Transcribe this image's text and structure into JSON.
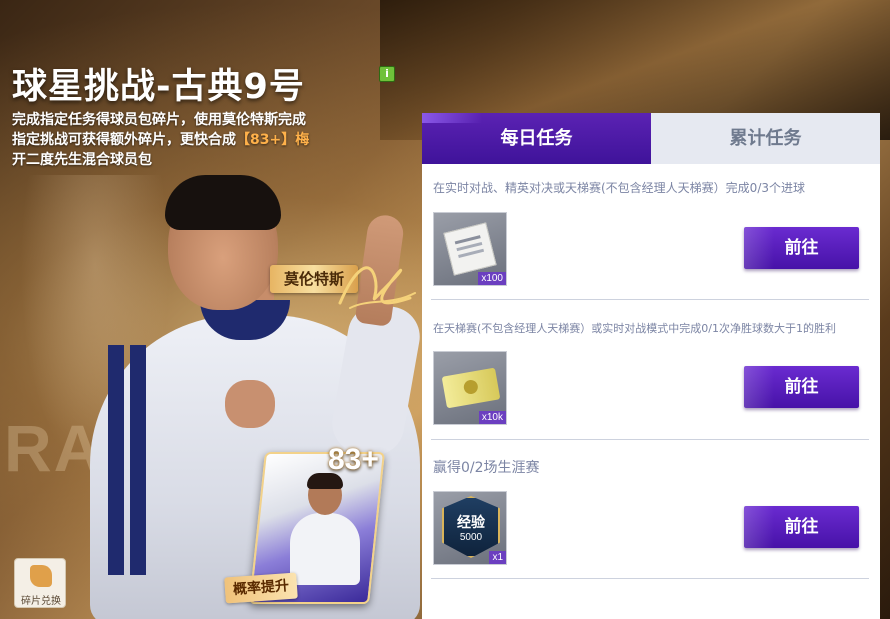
{
  "event": {
    "title": "球星挑战-古典9号",
    "info_icon": "i",
    "description_lines": [
      "完成指定任务得球员包碎片，使用莫伦特斯完成",
      "指定挑战可获得额外碎片，更快合成"
    ],
    "description_highlight": "【83+】",
    "description_tail": "梅",
    "description_last": "开二度先生混合球员包"
  },
  "hero": {
    "player_name": "莫伦特斯",
    "background_letters": "RA",
    "card_rating": "83+",
    "probability_tag": "概率提升"
  },
  "exchange": {
    "label": "碎片兑换",
    "icon": "puzzle-icon"
  },
  "tabs": [
    {
      "label": "每日任务",
      "active": true
    },
    {
      "label": "累计任务",
      "active": false
    }
  ],
  "tasks": [
    {
      "description": "在实时对战、精英对决或天梯赛(不包含经理人天梯赛）完成0/3个进球",
      "reward_icon": "document-icon",
      "reward_qty": "x100",
      "button": "前往"
    },
    {
      "description": "在天梯赛(不包含经理人天梯赛）或实时对战模式中完成0/1次净胜球数大于1的胜利",
      "reward_icon": "ticket-icon",
      "reward_qty": "x10k",
      "button": "前往"
    },
    {
      "description": "赢得0/2场生涯赛",
      "reward_icon": "exp-badge-icon",
      "reward_badge_title": "经验",
      "reward_badge_value": "5000",
      "reward_qty": "x1",
      "button": "前往"
    }
  ],
  "colors": {
    "accent": "#4f1aae",
    "tab_inactive": "#e6e9f1",
    "highlight": "#ffb14a"
  }
}
